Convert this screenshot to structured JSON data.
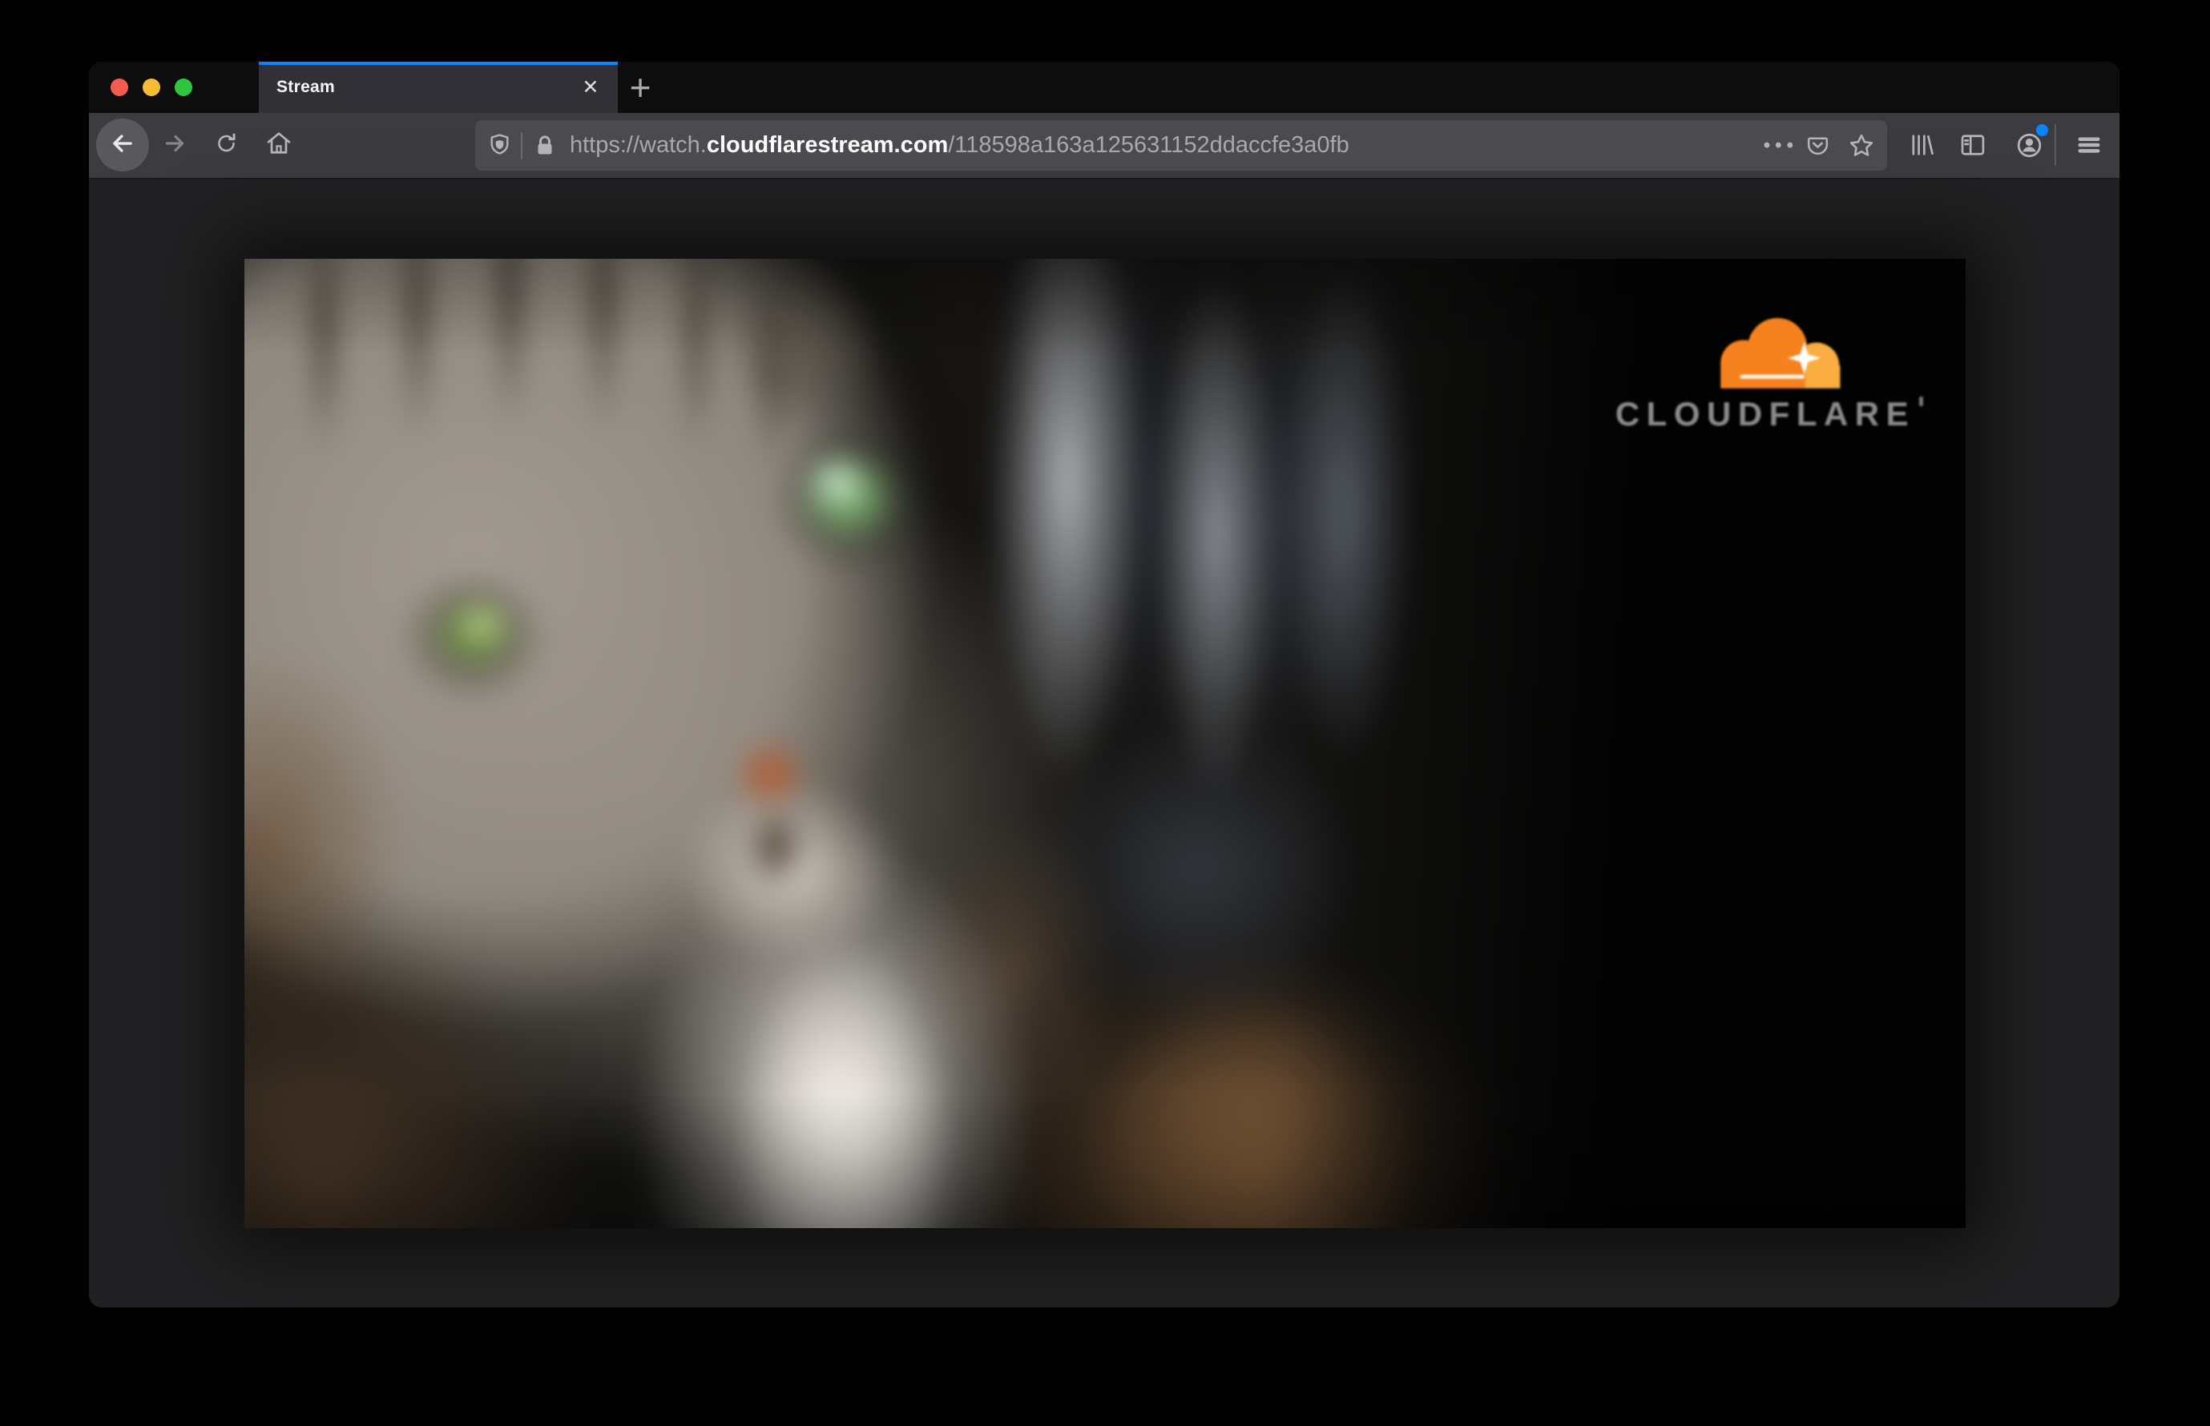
{
  "window_controls": {
    "close": "close",
    "minimize": "minimize",
    "zoom": "zoom"
  },
  "tab_bar": {
    "active_tab_title": "Stream",
    "tab_close_glyph": "✕",
    "new_tab_glyph": "+"
  },
  "toolbar": {
    "url_prefix": "https://watch.",
    "url_host": "cloudflarestream.com",
    "url_path": "/118598a163a125631152ddaccfe3a0fb",
    "page_actions_glyph": "•••"
  },
  "page": {
    "brand_wordmark": "CLOUDFLARE"
  },
  "icons": {
    "back": "arrow-left",
    "forward": "arrow-right",
    "reload": "circular-arrow",
    "home": "house",
    "tracking_protection": "shield",
    "connection_security": "lock",
    "page_actions": "three-dots",
    "pocket": "pocket-chevron",
    "bookmark": "star-outline",
    "library": "book-stack",
    "sidebar": "split-panel",
    "account": "person-circle",
    "menu": "hamburger",
    "tab_close": "x",
    "new_tab": "plus",
    "cloudflare": "cloud"
  },
  "colors": {
    "accent_blue": "#0a84ff",
    "cf_orange": "#f6821f",
    "cf_gold": "#fbad41",
    "wordmark_gray": "#8b8b8b",
    "traffic_red": "#f65b52",
    "traffic_yellow": "#f5bd33",
    "traffic_green": "#2fc53f",
    "badge_blue": "#0a84ff"
  }
}
